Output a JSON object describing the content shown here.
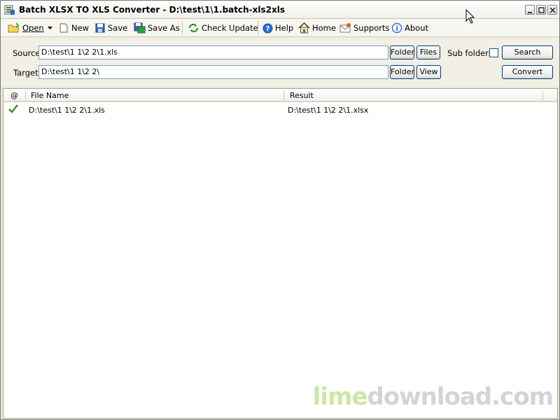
{
  "window": {
    "title": "Batch XLSX TO XLS Converter - D:\\test\\1\\1.batch-xls2xls"
  },
  "toolbar": {
    "open": "Open",
    "new": "New",
    "save": "Save",
    "save_as": "Save As",
    "check_update": "Check Update",
    "help": "Help",
    "home": "Home",
    "supports": "Supports",
    "about": "About"
  },
  "form": {
    "source_label": "Source",
    "source_value": "D:\\test\\1 1\\2 2\\1.xls",
    "target_label": "Target",
    "target_value": "D:\\test\\1 1\\2 2\\",
    "folder_label": "Folder",
    "files_label": "Files",
    "view_label": "View",
    "subfolders_label": "Sub folders",
    "search_label": "Search",
    "convert_label": "Convert"
  },
  "list": {
    "columns": [
      "@",
      "File Name",
      "Result"
    ],
    "rows": [
      {
        "file": "D:\\test\\1 1\\2 2\\1.xls",
        "result": "D:\\test\\1 1\\2 2\\1.xlsx",
        "status": "success"
      }
    ]
  },
  "watermark": {
    "part1": "lime",
    "part2": "download.com"
  },
  "colors": {
    "success": "#3d8a1f",
    "accent": "#316ac5"
  }
}
